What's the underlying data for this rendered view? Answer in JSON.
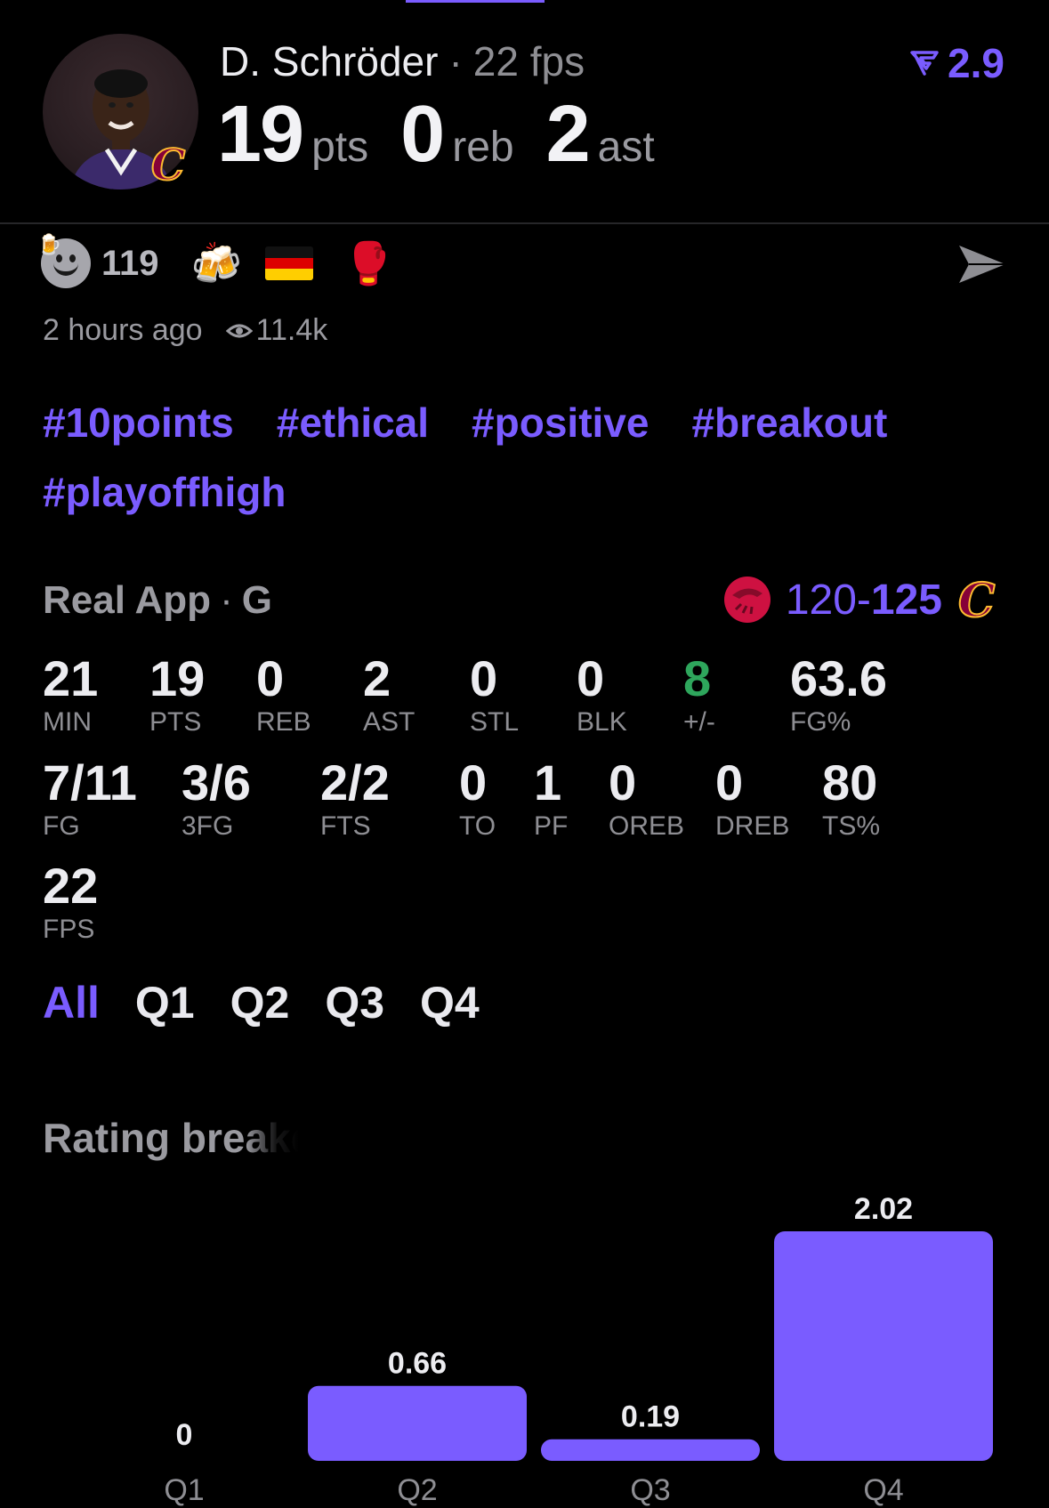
{
  "player": {
    "name": "D. Schröder",
    "fps_text": "22 fps",
    "rating": "2.9",
    "pts": "19",
    "pts_unit": "pts",
    "reb": "0",
    "reb_unit": "reb",
    "ast": "2",
    "ast_unit": "ast"
  },
  "reactions": {
    "count": "119",
    "items": [
      "beer-mugs-emoji",
      "germany-flag-emoji",
      "boxing-glove-emoji"
    ],
    "time_ago": "2 hours ago",
    "views": "11.4k"
  },
  "hashtags": [
    "#10points",
    "#ethical",
    "#positive",
    "#breakout",
    "#playoffhigh"
  ],
  "game": {
    "source": "Real App",
    "position": "G",
    "score_left": "120",
    "score_sep": "-",
    "score_right": "125"
  },
  "stats": {
    "row1": [
      {
        "v": "21",
        "l": "MIN"
      },
      {
        "v": "19",
        "l": "PTS"
      },
      {
        "v": "0",
        "l": "REB"
      },
      {
        "v": "2",
        "l": "AST"
      },
      {
        "v": "0",
        "l": "STL"
      },
      {
        "v": "0",
        "l": "BLK"
      },
      {
        "v": "8",
        "l": "+/-"
      },
      {
        "v": "63.6",
        "l": "FG%"
      }
    ],
    "row2": [
      {
        "v": "7/11",
        "l": "FG"
      },
      {
        "v": "3/6",
        "l": "3FG"
      },
      {
        "v": "2/2",
        "l": "FTS"
      },
      {
        "v": "0",
        "l": "TO"
      },
      {
        "v": "1",
        "l": "PF"
      },
      {
        "v": "0",
        "l": "OREB"
      },
      {
        "v": "0",
        "l": "DREB"
      },
      {
        "v": "80",
        "l": "TS%"
      }
    ],
    "row3": [
      {
        "v": "22",
        "l": "FPS"
      }
    ]
  },
  "quarter_tabs": [
    "All",
    "Q1",
    "Q2",
    "Q3",
    "Q4"
  ],
  "active_tab": "All",
  "breakdown_title": "Rating breakdo",
  "colors": {
    "accent": "#7a5cff",
    "positive": "#2ea65c",
    "muted": "#8e8e93"
  },
  "chart_data": {
    "type": "bar",
    "categories": [
      "Q1",
      "Q2",
      "Q3",
      "Q4"
    ],
    "values": [
      0,
      0.66,
      0.19,
      2.02
    ],
    "value_labels": [
      "0",
      "0.66",
      "0.19",
      "2.02"
    ],
    "title": "Rating breakdo",
    "ylim": [
      0,
      2.02
    ],
    "grid": false,
    "color": "#7a5cff"
  }
}
